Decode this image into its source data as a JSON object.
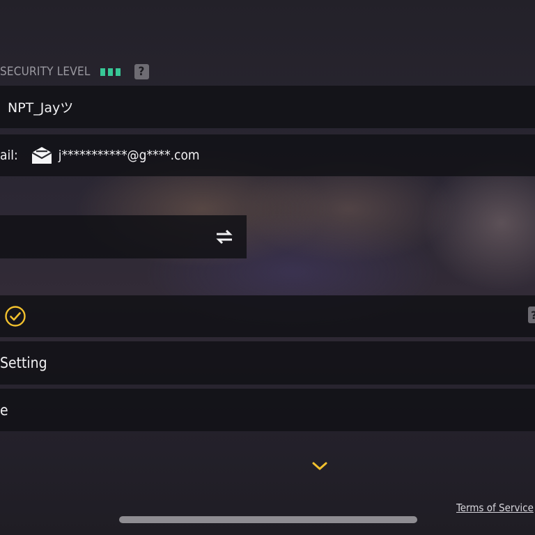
{
  "security": {
    "label": "SECURITY LEVEL",
    "bars_filled": 3,
    "bar_color": "#38c796",
    "help_label": "?"
  },
  "account": {
    "name": "NPT_Jayツ"
  },
  "email": {
    "label": "ail:",
    "value": "j***********@g****.com",
    "icon": "envelope-icon"
  },
  "switch_account": {
    "icon": "swap-arrows-icon"
  },
  "verification": {
    "icon": "check-circle-icon",
    "status_color": "#f2c12e",
    "help_label": "?"
  },
  "menu": {
    "setting_label": "Setting",
    "item2_label": "e"
  },
  "footer": {
    "expand_icon": "chevron-down-icon",
    "terms_label": "Terms of Service"
  },
  "colors": {
    "accent": "#f2c12e",
    "security_green": "#38c796"
  }
}
